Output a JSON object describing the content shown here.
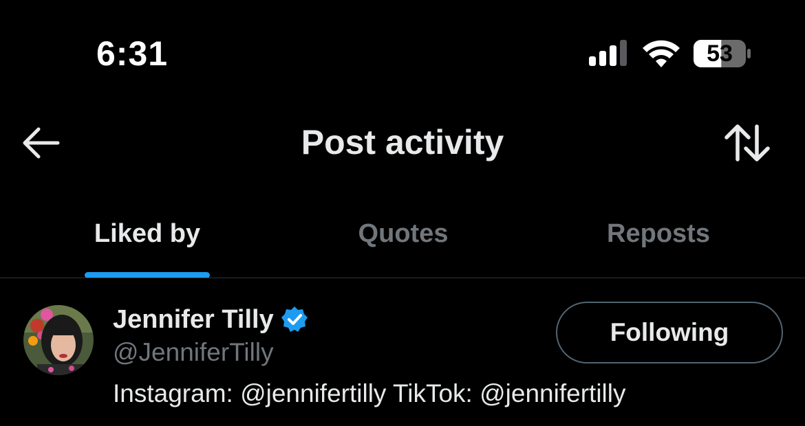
{
  "status_bar": {
    "time": "6:31",
    "battery_level": "53",
    "signal_bars_filled": 3,
    "signal_bars_total": 4,
    "icons": [
      "signal-icon",
      "wifi-icon",
      "battery-icon"
    ]
  },
  "header": {
    "title": "Post activity",
    "back_icon": "arrow-left-icon",
    "sort_icon": "sort-arrows-icon"
  },
  "tabs": [
    {
      "label": "Liked by",
      "active": true
    },
    {
      "label": "Quotes",
      "active": false
    },
    {
      "label": "Reposts",
      "active": false
    }
  ],
  "colors": {
    "accent": "#1d9bf0",
    "background": "#000000",
    "primary_text": "#e7e9ea",
    "secondary_text": "#71767b"
  },
  "users": [
    {
      "name": "Jennifer Tilly",
      "handle": "@JenniferTilly",
      "verified": true,
      "bio": "Instagram: @jennifertilly TikTok: @jennifertilly",
      "follow_button_label": "Following"
    }
  ]
}
